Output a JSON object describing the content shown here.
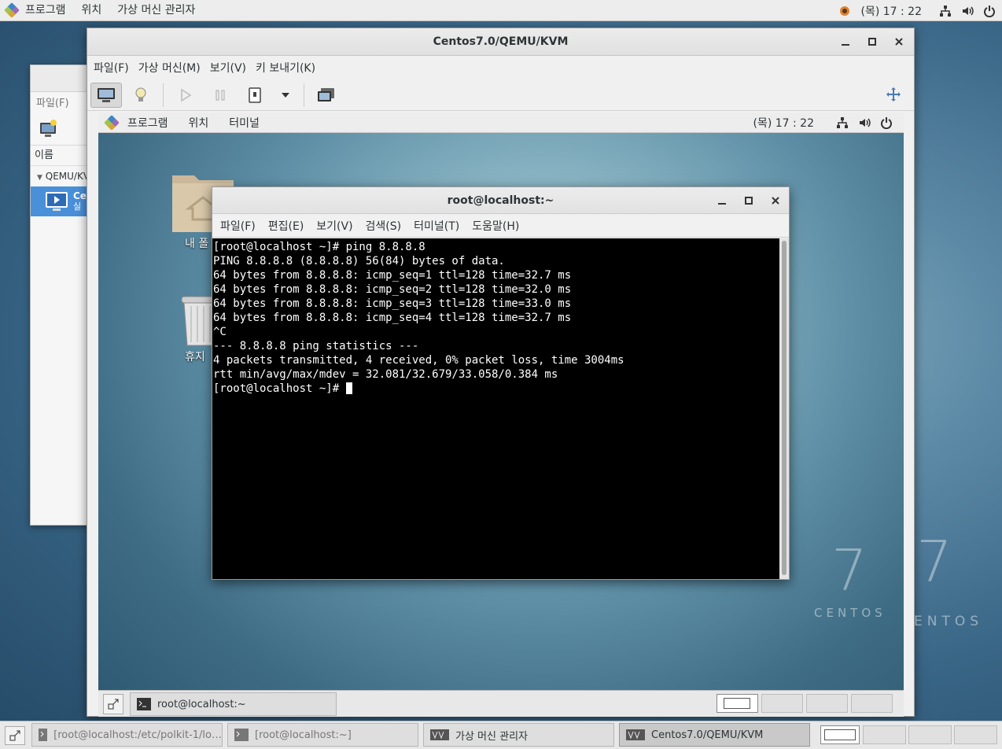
{
  "topbar": {
    "menus": [
      "프로그램",
      "위치",
      "가상 머신 관리자"
    ],
    "clock": "(목) 17 : 22"
  },
  "vmm_bg": {
    "menu": "파일(F)",
    "column": "이름",
    "group": "QEMU/KV",
    "item_name": "Ce",
    "item_status": "실"
  },
  "vm_window": {
    "title": "Centos7.0/QEMU/KVM",
    "menus": [
      "파일(F)",
      "가상 머신(M)",
      "보기(V)",
      "키 보내기(K)"
    ]
  },
  "guest": {
    "topbar": {
      "menus": [
        "프로그램",
        "위치",
        "터미널"
      ],
      "clock": "(목) 17 : 22"
    },
    "desktop_icons": [
      "내 폴",
      "휴지"
    ],
    "logo": {
      "number": "7",
      "text": "CENTOS"
    },
    "taskbar": {
      "task_label": "root@localhost:~"
    }
  },
  "terminal": {
    "title": "root@localhost:~",
    "menus": [
      "파일(F)",
      "편집(E)",
      "보기(V)",
      "검색(S)",
      "터미널(T)",
      "도움말(H)"
    ],
    "lines": [
      "[root@localhost ~]# ping 8.8.8.8",
      "PING 8.8.8.8 (8.8.8.8) 56(84) bytes of data.",
      "64 bytes from 8.8.8.8: icmp_seq=1 ttl=128 time=32.7 ms",
      "64 bytes from 8.8.8.8: icmp_seq=2 ttl=128 time=32.0 ms",
      "64 bytes from 8.8.8.8: icmp_seq=3 ttl=128 time=33.0 ms",
      "64 bytes from 8.8.8.8: icmp_seq=4 ttl=128 time=32.7 ms",
      "^C",
      "--- 8.8.8.8 ping statistics ---",
      "4 packets transmitted, 4 received, 0% packet loss, time 3004ms",
      "rtt min/avg/max/mdev = 32.081/32.679/33.058/0.384 ms"
    ],
    "prompt": "[root@localhost ~]# "
  },
  "host_taskbar": {
    "tasks": [
      "[root@localhost:/etc/polkit-1/lo…",
      "[root@localhost:~]",
      "가상 머신 관리자",
      "Centos7.0/QEMU/KVM"
    ]
  }
}
